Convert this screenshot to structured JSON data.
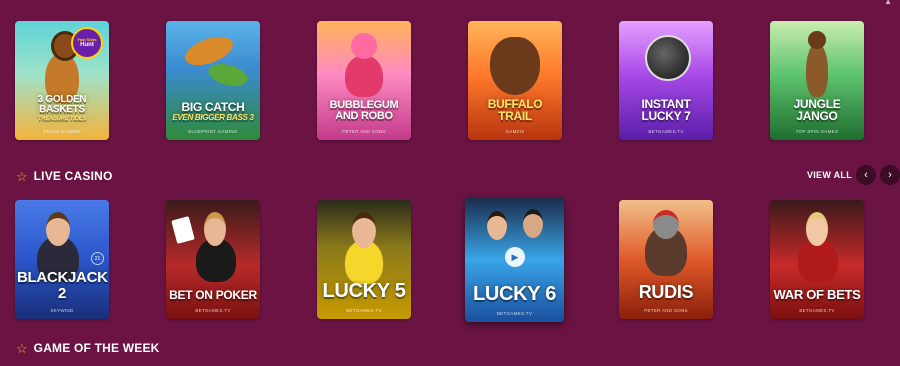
{
  "top_games": [
    {
      "title": "3 Golden Baskets",
      "sub": "Treasure Tides",
      "provider": "Relax Gaming",
      "badge_top": "Fast Slots",
      "badge_main": "Hunt",
      "colors": [
        "#5fd3d9",
        "#f3b23a"
      ]
    },
    {
      "title": "Big Catch",
      "sub": "Even Bigger Bass 3",
      "provider": "Blueprint Gaming",
      "colors": [
        "#3b8bd0",
        "#2f8a3a"
      ]
    },
    {
      "title": "Bubblegum and Robo",
      "sub": "",
      "provider": "Peter and Sons",
      "colors": [
        "#ff8ac2",
        "#c23a8a"
      ]
    },
    {
      "title": "Buffalo Trail",
      "sub": "",
      "provider": "Gamzix",
      "colors": [
        "#ff9a2b",
        "#b8350f"
      ]
    },
    {
      "title": "Instant Lucky 7",
      "sub": "",
      "provider": "Betgames.tv",
      "colors": [
        "#c56bff",
        "#5a1ea8"
      ]
    },
    {
      "title": "Jungle Jango",
      "sub": "",
      "provider": "Top Spin Games",
      "colors": [
        "#5ec46e",
        "#1f6e2f"
      ]
    }
  ],
  "live_section": {
    "label": "LIVE CASINO",
    "view_all": "VIEW ALL",
    "prev_icon": "‹",
    "next_icon": "›"
  },
  "live_games": [
    {
      "title": "Blackjack 2",
      "provider": "Skywind",
      "colors": [
        "#2a56c9",
        "#1a2f7a"
      ],
      "icon": "21"
    },
    {
      "title": "Bet on Poker",
      "provider": "Betgames.tv",
      "colors": [
        "#e04a4a",
        "#7a1010"
      ]
    },
    {
      "title": "Lucky 5",
      "provider": "Betgames.tv",
      "colors": [
        "#ffe14a",
        "#c89a00"
      ]
    },
    {
      "title": "Lucky 6",
      "provider": "Betgames.tv",
      "colors": [
        "#3aa5e8",
        "#1a4f9e"
      ],
      "play": "▶"
    },
    {
      "title": "Rudis",
      "provider": "Peter and Sons",
      "colors": [
        "#e05a2a",
        "#8a1f0a"
      ]
    },
    {
      "title": "War of Bets",
      "provider": "Betgames.tv",
      "colors": [
        "#e03838",
        "#7a0f0f"
      ]
    }
  ],
  "week_section": {
    "label": "GAME OF THE WEEK"
  },
  "star_icon": "☆"
}
